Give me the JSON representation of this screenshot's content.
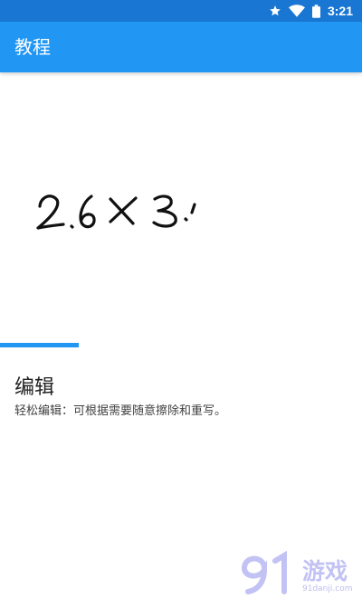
{
  "status_bar": {
    "time": "3:21",
    "icons": [
      "star-icon",
      "wifi-icon",
      "battery-icon"
    ]
  },
  "app_bar": {
    "title": "教程"
  },
  "drawing": {
    "handwritten_text": "2.6×3.'"
  },
  "progress": {
    "value": 0.22
  },
  "content": {
    "title": "编辑",
    "description": "轻松编辑：可根据需要随意擦除和重写。"
  },
  "watermark": {
    "logo_text": "游戏",
    "site": "91danji.com"
  },
  "colors": {
    "status_bar": "#1976d2",
    "app_bar": "#2196f3",
    "accent": "#2196f3",
    "title_text": "#212121",
    "body_text": "#424242"
  }
}
